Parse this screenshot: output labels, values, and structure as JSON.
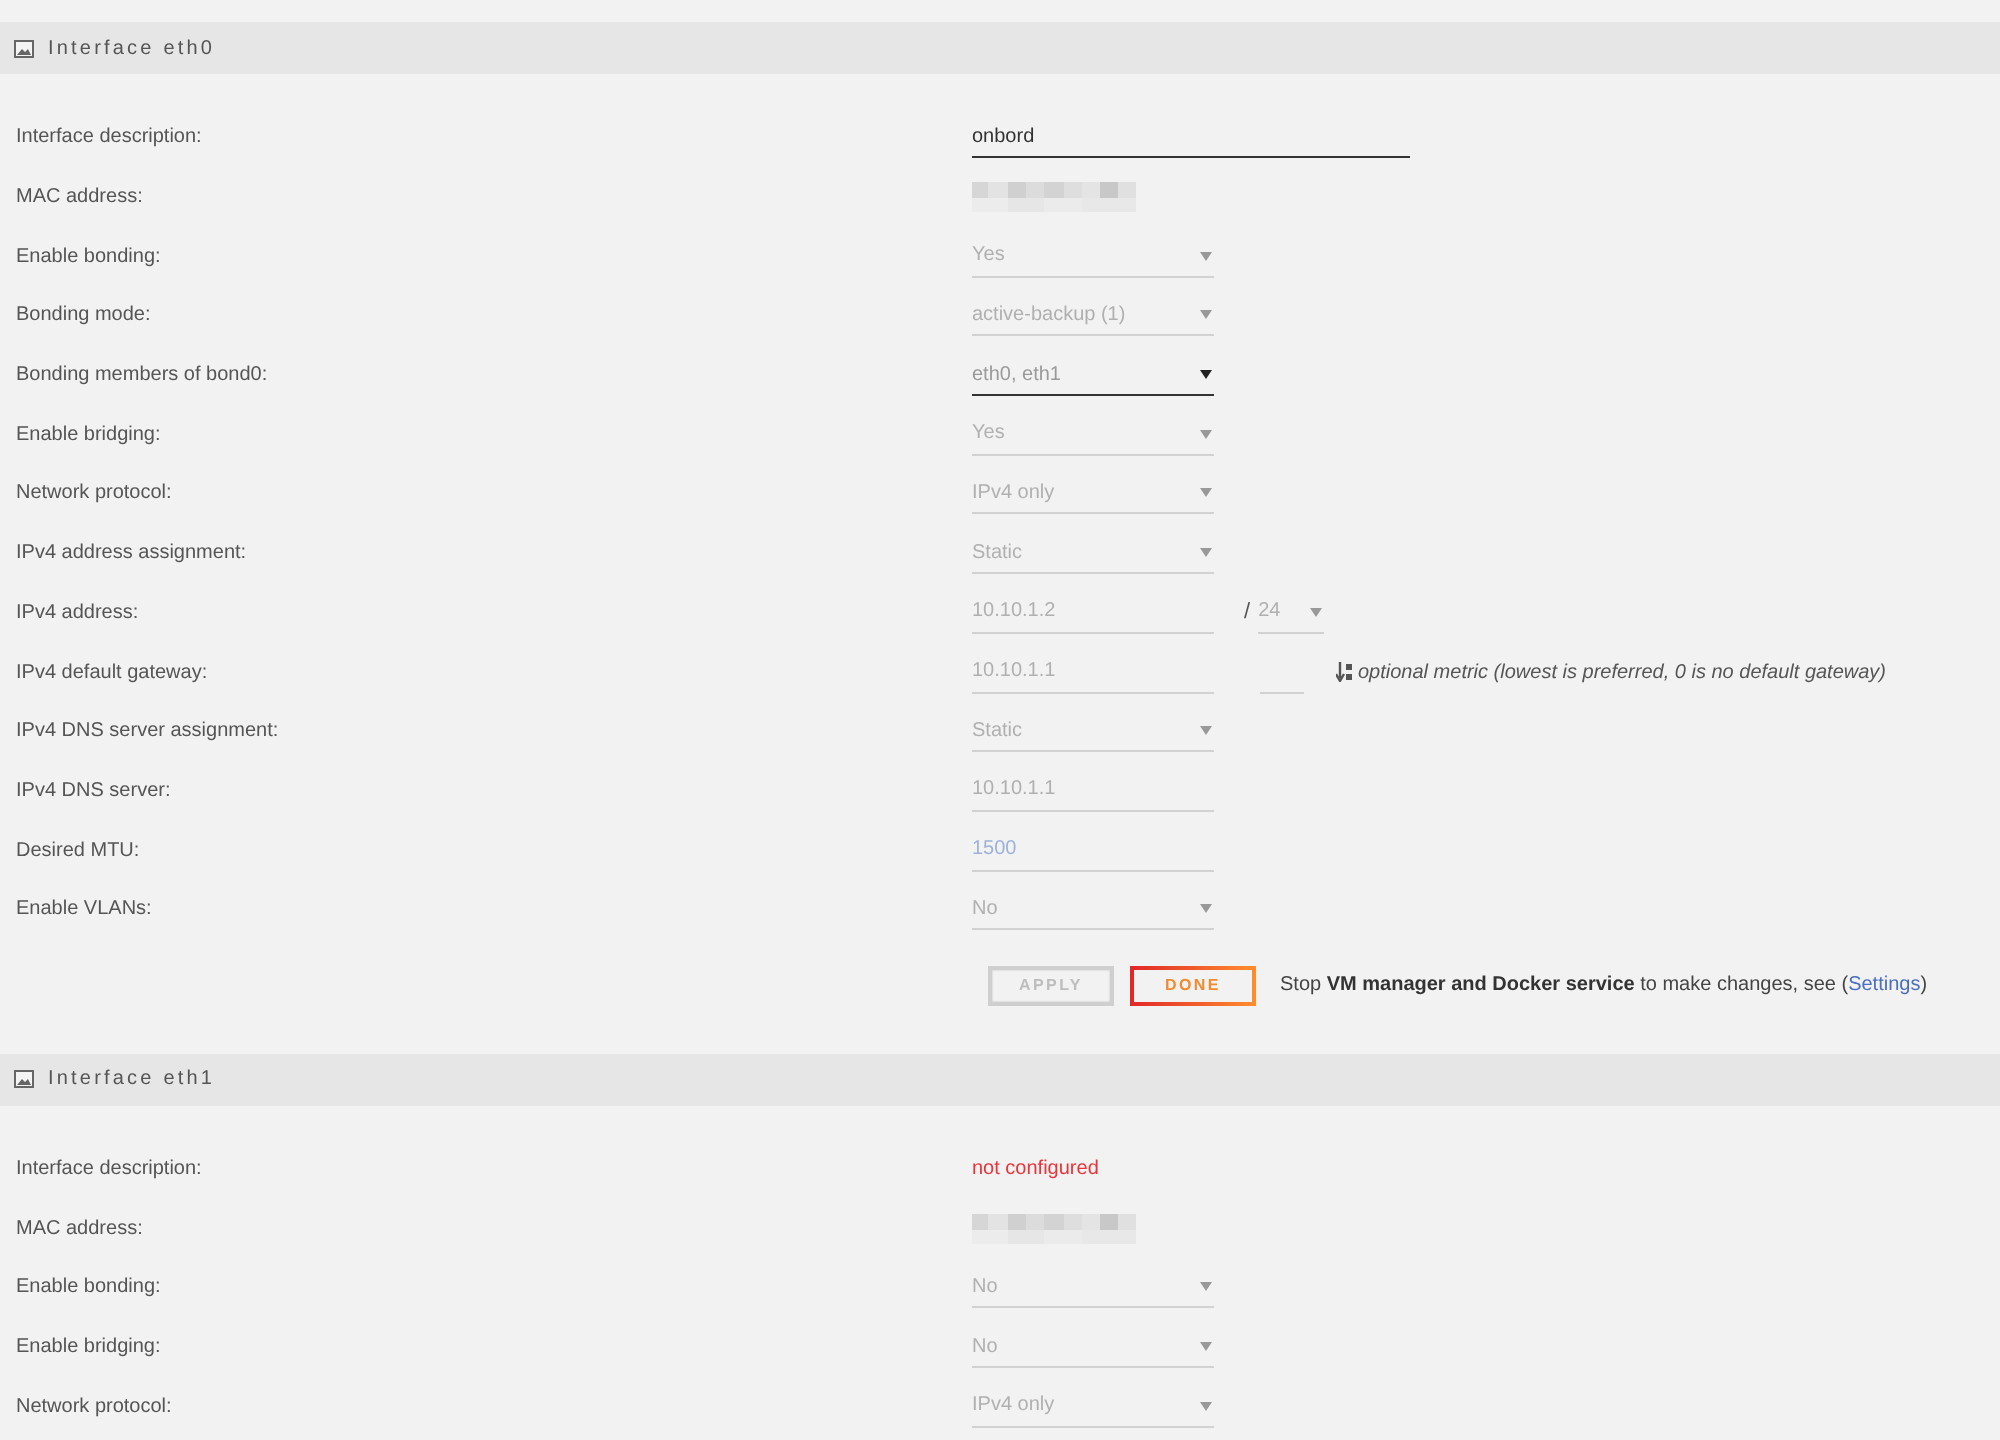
{
  "sections": [
    {
      "title": "Interface eth0",
      "rows": [
        {
          "label": "Interface description:",
          "controls": [
            {
              "kind": "wide_input",
              "value": "onbord",
              "disabled": false
            }
          ]
        },
        {
          "label": "MAC address:",
          "controls": [
            {
              "kind": "redacted"
            }
          ]
        },
        {
          "label": "Enable bonding:",
          "controls": [
            {
              "kind": "select",
              "value": "Yes",
              "disabled": true
            }
          ]
        },
        {
          "label": "Bonding mode:",
          "controls": [
            {
              "kind": "select",
              "value": "active-backup (1)",
              "disabled": true
            }
          ]
        },
        {
          "label": "Bonding members of bond0:",
          "controls": [
            {
              "kind": "select",
              "value": "eth0, eth1",
              "disabled": false
            }
          ]
        },
        {
          "label": "Enable bridging:",
          "controls": [
            {
              "kind": "select",
              "value": "Yes",
              "disabled": true
            }
          ]
        },
        {
          "label": "Network protocol:",
          "controls": [
            {
              "kind": "select",
              "value": "IPv4 only",
              "disabled": true
            }
          ]
        },
        {
          "label": "IPv4 address assignment:",
          "controls": [
            {
              "kind": "select",
              "value": "Static",
              "disabled": true
            }
          ]
        },
        {
          "label": "IPv4 address:",
          "controls": [
            {
              "kind": "input",
              "value": "10.10.1.2",
              "disabled": true
            },
            {
              "kind": "separator",
              "text": "/"
            },
            {
              "kind": "small_select",
              "value": "24",
              "disabled": true
            }
          ]
        },
        {
          "label": "IPv4 default gateway:",
          "controls": [
            {
              "kind": "input",
              "value": "10.10.1.1",
              "disabled": true
            },
            {
              "kind": "small_input",
              "disabled": true
            },
            {
              "kind": "hint",
              "text": "optional metric (lowest is preferred, 0 is no default gateway)"
            }
          ]
        },
        {
          "label": "IPv4 DNS server assignment:",
          "controls": [
            {
              "kind": "select",
              "value": "Static",
              "disabled": true
            }
          ]
        },
        {
          "label": "IPv4 DNS server:",
          "controls": [
            {
              "kind": "input",
              "value": "10.10.1.1",
              "disabled": true
            }
          ]
        },
        {
          "label": "Desired MTU:",
          "controls": [
            {
              "kind": "input",
              "placeholder": "1500",
              "disabled": true
            }
          ]
        },
        {
          "label": "Enable VLANs:",
          "controls": [
            {
              "kind": "select",
              "value": "No",
              "disabled": true
            }
          ]
        }
      ],
      "buttons": [
        {
          "label": "APPLY",
          "disabled": true
        },
        {
          "label": "DONE",
          "disabled": false
        }
      ],
      "notice": {
        "text": "Stop **VM manager and Docker service** to make changes, see (",
        "link": "Settings",
        "after": ")"
      }
    },
    {
      "title": "Interface eth1",
      "rows": [
        {
          "label": "Interface description:",
          "controls": [
            {
              "kind": "status",
              "text": "not configured"
            }
          ]
        },
        {
          "label": "MAC address:",
          "controls": [
            {
              "kind": "redacted"
            }
          ]
        },
        {
          "label": "Enable bonding:",
          "controls": [
            {
              "kind": "select",
              "value": "No",
              "disabled": true
            }
          ]
        },
        {
          "label": "Enable bridging:",
          "controls": [
            {
              "kind": "select",
              "value": "No",
              "disabled": true
            }
          ]
        },
        {
          "label": "Network protocol:",
          "controls": [
            {
              "kind": "select",
              "value": "IPv4 only",
              "disabled": true
            }
          ]
        }
      ]
    }
  ]
}
